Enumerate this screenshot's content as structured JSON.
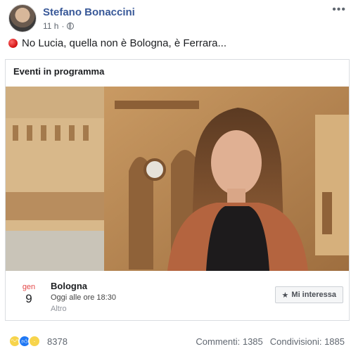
{
  "post": {
    "author": "Stefano Bonaccini",
    "time": "11 h",
    "separator": "·",
    "text": "No Lucia, quella non è Bologna, è Ferrara...",
    "more_icon": "ellipsis-icon",
    "privacy_icon": "globe-icon"
  },
  "event_card": {
    "section_title": "Eventi in programma",
    "month": "gen",
    "day": "9",
    "name": "Bologna",
    "time": "Oggi alle ore 18:30",
    "category": "Altro",
    "interest_button": "Mi interessa",
    "interest_icon": "star-icon"
  },
  "footer": {
    "reactions": [
      "haha",
      "like",
      "sad"
    ],
    "reaction_count": "8378",
    "comments": "Commenti: 1385",
    "shares": "Condivisioni: 1885"
  },
  "colors": {
    "author_link": "#385898",
    "month_red": "#e4494a",
    "like_blue": "#2078f4"
  }
}
